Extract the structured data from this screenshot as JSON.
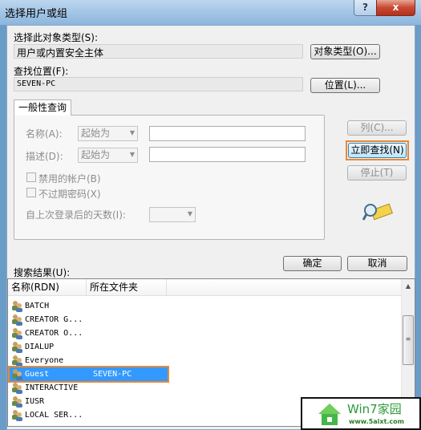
{
  "window": {
    "title": "选择用户或组",
    "help": "?",
    "close": "x"
  },
  "object_type": {
    "label": "选择此对象类型(S):",
    "value": "用户或内置安全主体",
    "button": "对象类型(O)..."
  },
  "location": {
    "label": "查找位置(F):",
    "value": "SEVEN-PC",
    "button": "位置(L)..."
  },
  "query": {
    "tab": "一般性查询",
    "name_label": "名称(A):",
    "name_mode": "起始为",
    "name_value": "",
    "desc_label": "描述(D):",
    "desc_mode": "起始为",
    "desc_value": "",
    "disabled_accounts": "禁用的帐户(B)",
    "non_expiring": "不过期密码(X)",
    "days_label": "自上次登录后的天数(I):",
    "days_value": ""
  },
  "buttons": {
    "columns": "列(C)...",
    "find_now": "立即查找(N)",
    "stop": "停止(T)",
    "ok": "确定",
    "cancel": "取消"
  },
  "highlight_color": "#e58a3a",
  "results": {
    "label": "搜索结果(U):",
    "columns": [
      "名称(RDN)",
      "所在文件夹"
    ],
    "rows": [
      {
        "name": "BATCH",
        "folder": ""
      },
      {
        "name": "CREATOR G...",
        "folder": ""
      },
      {
        "name": "CREATOR O...",
        "folder": ""
      },
      {
        "name": "DIALUP",
        "folder": ""
      },
      {
        "name": "Everyone",
        "folder": ""
      },
      {
        "name": "Guest",
        "folder": "SEVEN-PC",
        "selected": true
      },
      {
        "name": "INTERACTIVE",
        "folder": ""
      },
      {
        "name": "IUSR",
        "folder": ""
      },
      {
        "name": "LOCAL SER...",
        "folder": ""
      }
    ]
  },
  "watermark": {
    "brand": "Win7家园",
    "url": "www.5aixt.com"
  }
}
